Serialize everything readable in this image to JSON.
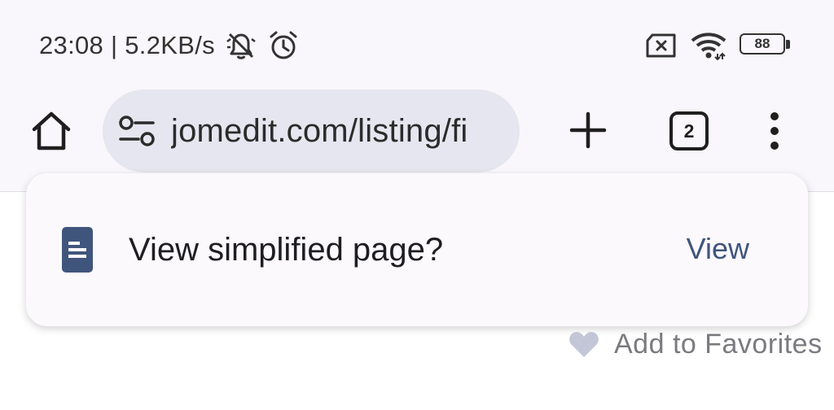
{
  "status_bar": {
    "time_speed": "23:08 | 5.2KB/s",
    "battery_level": "88"
  },
  "toolbar": {
    "url": "jomedit.com/listing/fi",
    "tab_count": "2"
  },
  "prompt": {
    "message": "View simplified page?",
    "action_label": "View"
  },
  "page": {
    "favorites_label": "Add to Favorites"
  },
  "colors": {
    "accent": "#40557c",
    "urlbar_bg": "#e5e6ef",
    "heart": "#c3c6d6"
  }
}
